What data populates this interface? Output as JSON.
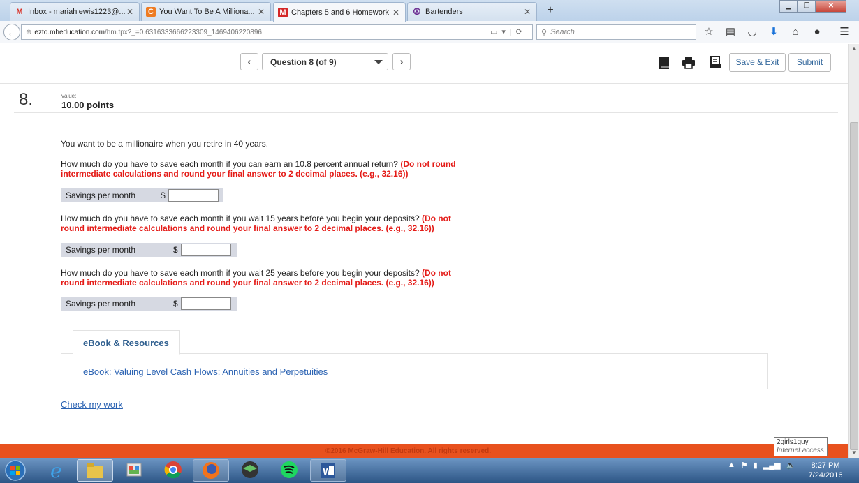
{
  "browser": {
    "tabs": [
      {
        "title": "Inbox - mariahlewis1223@...",
        "icon": "gmail-icon",
        "active": false
      },
      {
        "title": "You Want To Be A Milliona...",
        "icon": "chegg-icon",
        "active": false
      },
      {
        "title": "Chapters 5 and 6 Homework",
        "icon": "mcgraw-hill-icon",
        "active": true
      },
      {
        "title": "Bartenders",
        "icon": "peace-icon",
        "active": false
      }
    ],
    "url_host": "ezto.mheducation.com",
    "url_path": "/hm.tpx?_=0.6316333666223309_1469406220896",
    "search_placeholder": "Search"
  },
  "toolbar": {
    "question_select": "Question 8 (of 9)",
    "save_exit_label": "Save & Exit",
    "submit_label": "Submit"
  },
  "question": {
    "number": "8.",
    "value_label": "value:",
    "points": "10.00 points",
    "intro": "You want to be a millionaire when you retire in 40 years.",
    "parts": [
      {
        "prompt": "How much do you have to save each month if you can earn an 10.8 percent annual return?",
        "instruction": "(Do not round intermediate calculations and round your final answer to 2 decimal places. (e.g., 32.16))",
        "label": "Savings per month",
        "currency": "$",
        "value": ""
      },
      {
        "prompt": "How much do you have to save each month if you wait 15 years before you begin your deposits?",
        "instruction": "(Do not round intermediate calculations and round your final answer to 2 decimal places. (e.g., 32.16))",
        "label": "Savings per month",
        "currency": "$",
        "value": ""
      },
      {
        "prompt": "How much do you have to save each month if you wait 25 years before you begin your deposits?",
        "instruction": "(Do not round intermediate calculations and round your final answer to 2 decimal places. (e.g., 32.16))",
        "label": "Savings per month",
        "currency": "$",
        "value": ""
      }
    ]
  },
  "resources": {
    "tab_label": "eBook & Resources",
    "ebook_link": "eBook: Valuing Level Cash Flows: Annuities and Perpetuities"
  },
  "check_work_label": "Check my work",
  "footer": {
    "copyright": "©2016 McGraw-Hill Education. All rights reserved."
  },
  "network_tooltip": {
    "name": "2girls1guy",
    "status": "Internet access"
  },
  "taskbar": {
    "time": "8:27 PM",
    "date": "7/24/2016"
  },
  "colors": {
    "instruction_red": "#e41b17",
    "footer_orange": "#e8511e",
    "link_blue": "#2a62b2"
  }
}
